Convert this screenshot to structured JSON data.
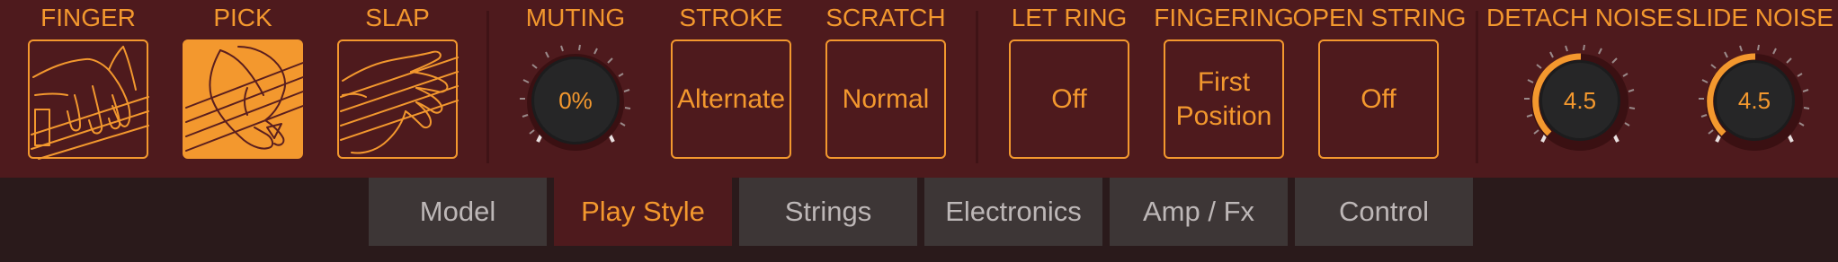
{
  "colors": {
    "accent": "#f3982e",
    "panel": "#4e1a1d",
    "background": "#2a1a1b",
    "tab": "#3d3636",
    "tab_text": "#bdb7b7"
  },
  "play_style": {
    "label_finger": "FINGER",
    "label_pick": "PICK",
    "label_slap": "SLAP",
    "selected": "PICK",
    "icons": {
      "finger": "finger-hand-icon",
      "pick": "pick-hand-icon",
      "slap": "slap-hand-icon"
    }
  },
  "muting": {
    "label": "MUTING",
    "value_text": "0%",
    "value": 0
  },
  "stroke": {
    "label": "STROKE",
    "value": "Alternate"
  },
  "scratch": {
    "label": "SCRATCH",
    "value": "Normal"
  },
  "let_ring": {
    "label": "LET RING",
    "value": "Off"
  },
  "fingering": {
    "label": "FINGERING",
    "value_line1": "First",
    "value_line2": "Position"
  },
  "open_string": {
    "label": "OPEN STRING",
    "value": "Off"
  },
  "detach_noise": {
    "label": "DETACH NOISE",
    "value_text": "4.5",
    "value": 0.45
  },
  "slide_noise": {
    "label": "SLIDE NOISE",
    "value_text": "4.5",
    "value": 0.45
  },
  "tabs": {
    "model": "Model",
    "play_style": "Play Style",
    "strings": "Strings",
    "electronics": "Electronics",
    "amp_fx": "Amp / Fx",
    "control": "Control",
    "active": "Play Style"
  }
}
